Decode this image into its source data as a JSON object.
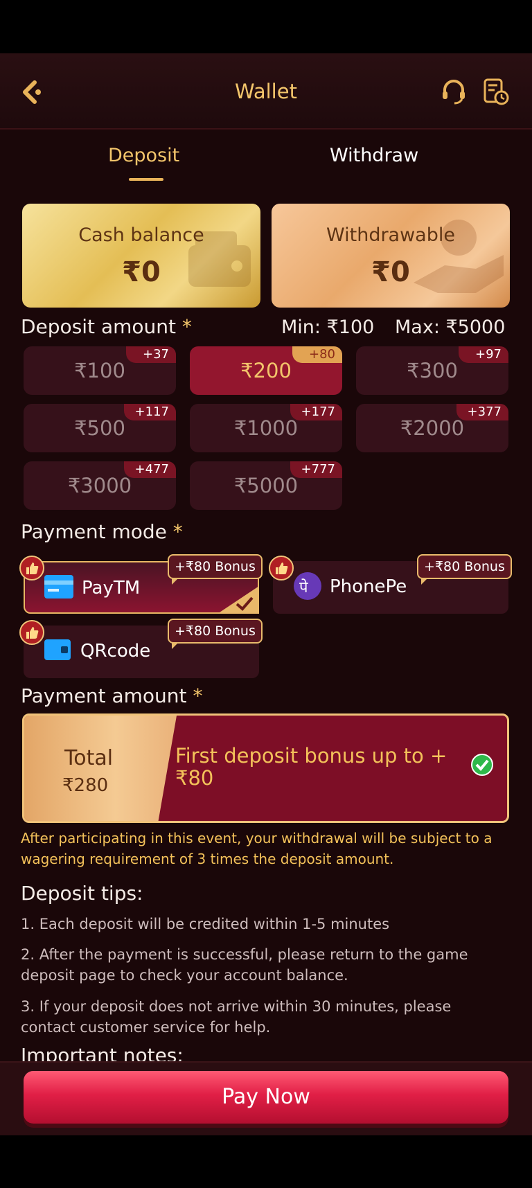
{
  "header": {
    "title": "Wallet"
  },
  "tabs": {
    "deposit": "Deposit",
    "withdraw": "Withdraw"
  },
  "balances": {
    "cash": {
      "label": "Cash balance",
      "value": "₹0"
    },
    "withdrawable": {
      "label": "Withdrawable",
      "value": "₹0"
    }
  },
  "deposit_amount": {
    "label": "Deposit amount",
    "required_mark": "*",
    "min": "Min: ₹100",
    "max": "Max: ₹5000",
    "options": [
      {
        "value": "₹100",
        "bonus": "+37",
        "selected": false
      },
      {
        "value": "₹200",
        "bonus": "+80",
        "selected": true
      },
      {
        "value": "₹300",
        "bonus": "+97",
        "selected": false
      },
      {
        "value": "₹500",
        "bonus": "+117",
        "selected": false
      },
      {
        "value": "₹1000",
        "bonus": "+177",
        "selected": false
      },
      {
        "value": "₹2000",
        "bonus": "+377",
        "selected": false
      },
      {
        "value": "₹3000",
        "bonus": "+477",
        "selected": false
      },
      {
        "value": "₹5000",
        "bonus": "+777",
        "selected": false
      }
    ]
  },
  "payment_mode": {
    "label": "Payment mode",
    "required_mark": "*",
    "options": [
      {
        "name": "PayTM",
        "bonus": "+₹80 Bonus",
        "icon": "card-icon",
        "selected": true
      },
      {
        "name": "PhonePe",
        "bonus": "+₹80 Bonus",
        "icon": "phonepe-icon",
        "selected": false
      },
      {
        "name": "QRcode",
        "bonus": "+₹80 Bonus",
        "icon": "wallet-icon",
        "selected": false
      }
    ],
    "phonepe_glyph": "पे"
  },
  "payment_amount": {
    "label": "Payment amount",
    "required_mark": "*",
    "total_label": "Total",
    "total_value": "₹280",
    "bonus_text": "First deposit bonus up to +₹80"
  },
  "notice": "After participating in this event, your withdrawal will be subject to a wagering requirement of 3 times the deposit amount.",
  "tips": {
    "title": "Deposit tips:",
    "items": [
      "1. Each deposit will be credited within 1-5 minutes",
      "2. After the payment is successful, please return to the game deposit page to check your account balance.",
      "3. If your deposit does not arrive within 30 minutes, please contact customer service for help."
    ],
    "important_title": "Important notes:"
  },
  "footer": {
    "pay_now": "Pay Now"
  },
  "colors": {
    "accent": "#f3c56b",
    "selected": "#93162e",
    "button": "#e11f46"
  }
}
